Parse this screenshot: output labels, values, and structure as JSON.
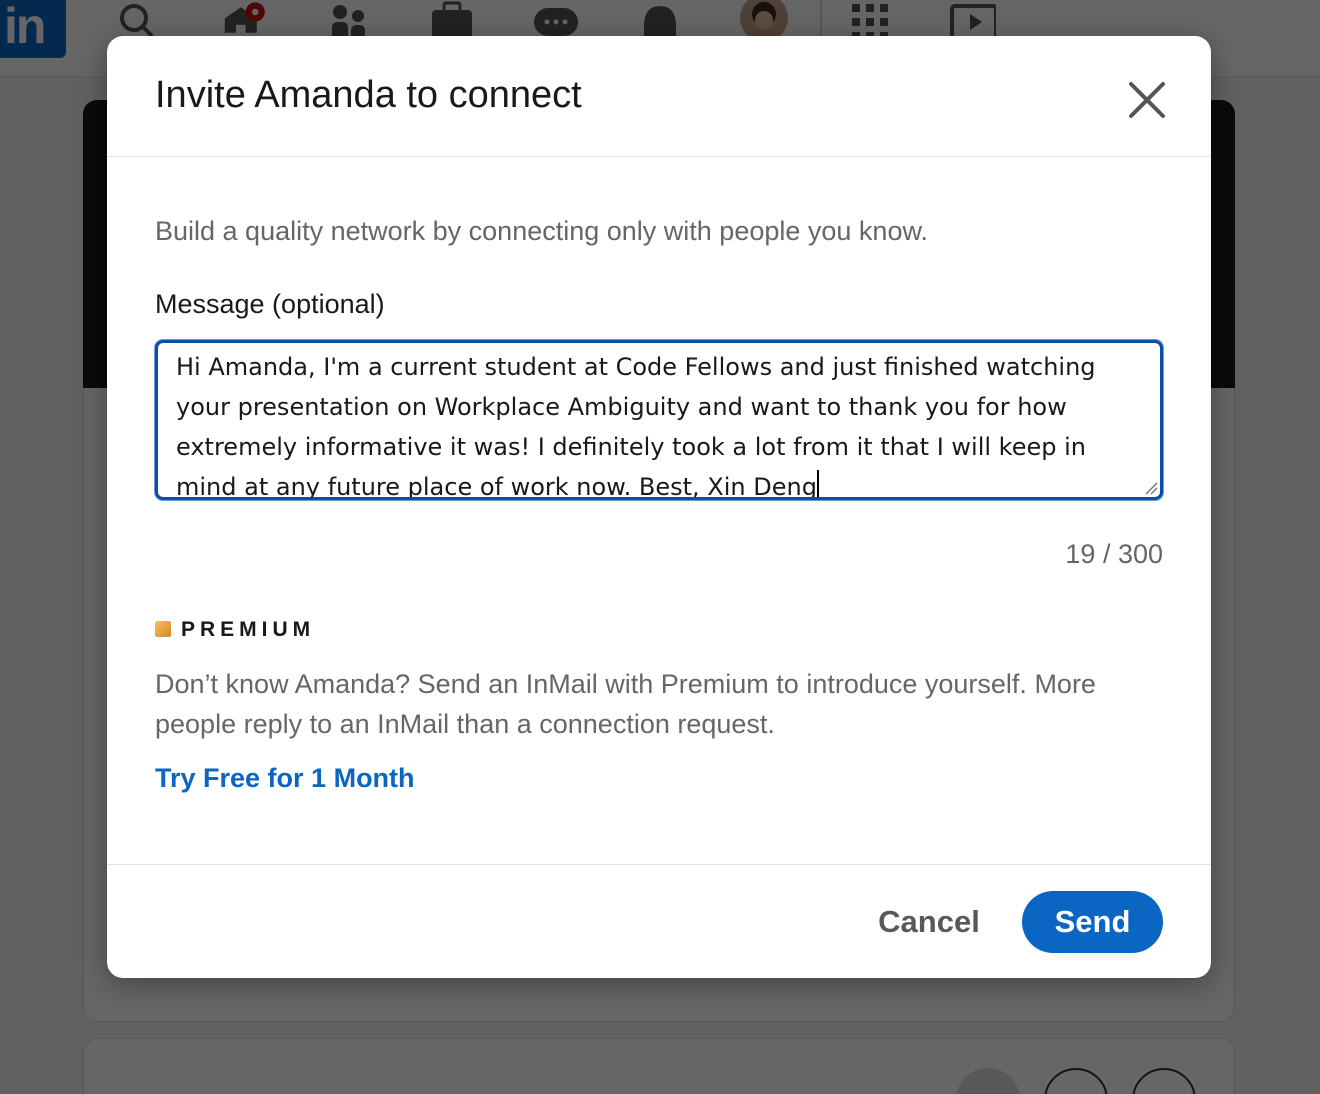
{
  "nav": {
    "logo_text": "in",
    "icons": [
      "search-icon",
      "home-icon",
      "network-icon",
      "jobs-icon",
      "messaging-icon",
      "notifications-icon",
      "avatar",
      "apps-grid-icon",
      "learning-icon"
    ],
    "home_badge_color": "#cc1016"
  },
  "modal": {
    "title": "Invite Amanda to connect",
    "subtitle": "Build a quality network by connecting only with people you know.",
    "message_label": "Message (optional)",
    "message_value": "Hi Amanda, I'm a current student at Code Fellows and just finished watching your presentation on Workplace Ambiguity and want to thank you for how extremely informative it was! I definitely took a lot from it that I will keep in mind at any future place of work now. Best, Xin Deng",
    "char_count": "19 / 300",
    "premium_label": "PREMIUM",
    "premium_desc": "Don’t know Amanda? Send an InMail with Premium to introduce yourself. More people reply to an InMail than a connection request.",
    "try_link": "Try Free for 1 Month",
    "cancel_label": "Cancel",
    "send_label": "Send"
  },
  "colors": {
    "accent": "#0a66c2",
    "text_primary": "#191919",
    "text_secondary": "#666666",
    "premium_gold": "#e7a33e"
  }
}
